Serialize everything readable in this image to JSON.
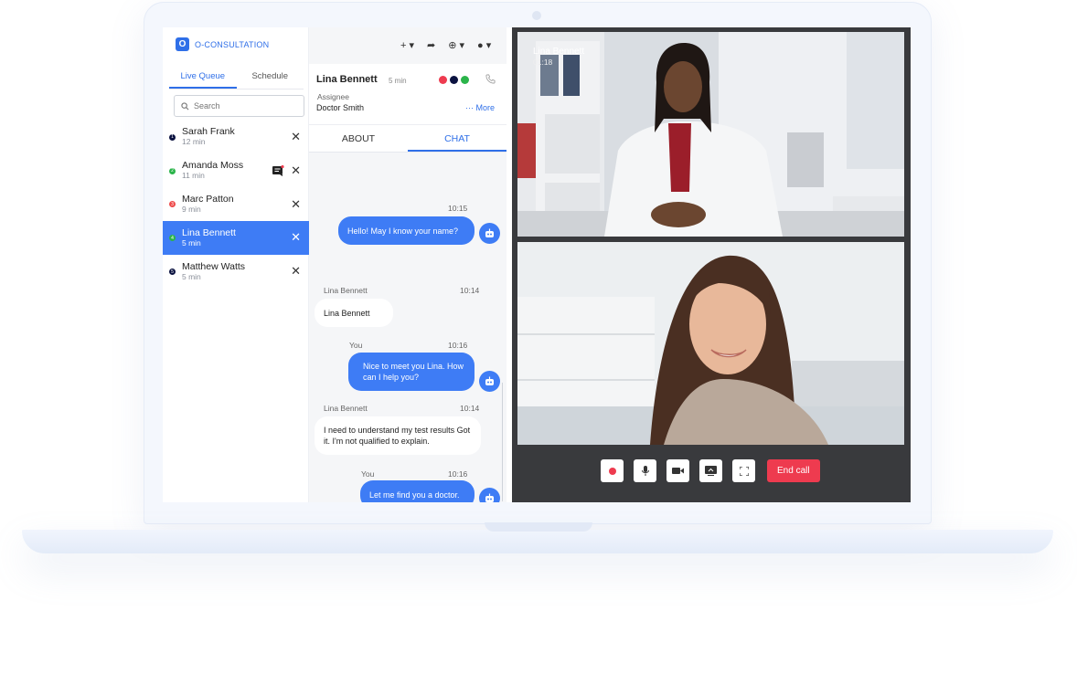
{
  "brand": {
    "name": "O-CONSULTATION",
    "logo_glyph": "O"
  },
  "header_icons": [
    "plus-icon",
    "share-icon",
    "globe-icon",
    "user-icon"
  ],
  "header_glyphs": {
    "plus": "+ ▾",
    "share": "➦",
    "globe": "⊕ ▾",
    "user": "● ▾"
  },
  "left_tabs": {
    "live_queue": "Live Queue",
    "schedule": "Schedule"
  },
  "search": {
    "placeholder": "Search"
  },
  "queue": [
    {
      "name": "Sarah Frank",
      "time": "12 min",
      "index": "1",
      "dot_color": "#0b1240"
    },
    {
      "name": "Amanda Moss",
      "time": "11 min",
      "index": "2",
      "dot_color": "#2bb44a"
    },
    {
      "name": "Marc Patton",
      "time": "9 min",
      "index": "3",
      "dot_color": "#ee4b4b"
    },
    {
      "name": "Lina Bennett",
      "time": "5 min",
      "index": "4",
      "dot_color": "#2bb44a"
    },
    {
      "name": "Matthew Watts",
      "time": "5 min",
      "index": "5",
      "dot_color": "#0b1240"
    }
  ],
  "close_glyph": "✕",
  "patient": {
    "name": "Lina Bennett",
    "time": "5 min",
    "assignee_label": "Assignee",
    "assignee": "Doctor Smith",
    "more": "··· More",
    "status_colors": [
      "#ee3b4f",
      "#0b1240",
      "#2bb44a"
    ]
  },
  "mid_tabs": {
    "about": "ABOUT",
    "chat": "CHAT"
  },
  "chat": {
    "m1_time": "10:15",
    "m1_text": "Hello! May I know your name?",
    "m2_who": "Lina Bennett",
    "m2_time": "10:14",
    "m2_text": "Lina Bennett",
    "m3_who": "You",
    "m3_time": "10:16",
    "m3_text": "Nice to meet you Lina. How can I help you?",
    "m4_who": "Lina Bennett",
    "m4_time": "10:14",
    "m4_text": "I need to understand my test results Got it. I'm not qualified to explain.",
    "m5_who": "You",
    "m5_time": "10:16",
    "m5_text": "Let me find you a doctor."
  },
  "video": {
    "caller_name": "Lina Bennett",
    "duration": "01:18",
    "end_call": "End call"
  },
  "colors": {
    "accent": "#3e7cf5",
    "end_call": "#ee3b4f"
  }
}
